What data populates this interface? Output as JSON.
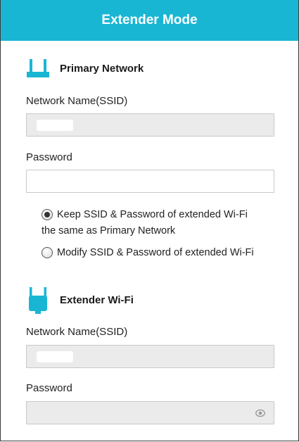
{
  "header": {
    "title": "Extender Mode"
  },
  "primary": {
    "title": "Primary Network",
    "ssid_label": "Network Name(SSID)",
    "ssid_value": "",
    "password_label": "Password",
    "password_value": ""
  },
  "options": {
    "keep_line1": "Keep SSID & Password of extended Wi-Fi",
    "keep_line2": "the same as Primary Network",
    "keep_selected": true,
    "modify": "Modify SSID & Password of extended Wi-Fi",
    "modify_selected": false
  },
  "extender": {
    "title": "Extender Wi-Fi",
    "ssid_label": "Network Name(SSID)",
    "ssid_value": "",
    "password_label": "Password",
    "password_value": ""
  },
  "colors": {
    "accent": "#19b6d4",
    "field_disabled": "#ebebeb",
    "border": "#c9c9c9"
  },
  "icons": {
    "primary": "router-icon",
    "extender": "extender-icon",
    "password_toggle": "eye-icon"
  }
}
